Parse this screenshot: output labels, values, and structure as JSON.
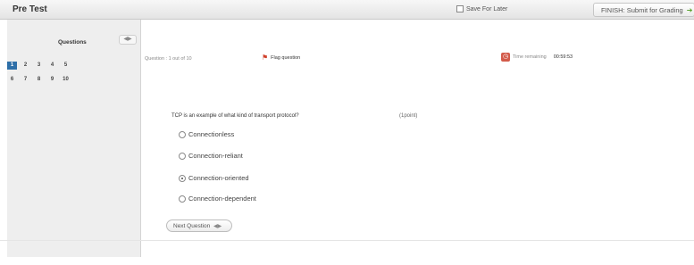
{
  "header": {
    "title": "Pre Test",
    "save_label": "Save For Later",
    "finish_label": "FINISH: Submit for Grading",
    "finish_arrow": "➔"
  },
  "sidebar": {
    "heading": "Questions",
    "collapse_icon": "◀▶",
    "row1": [
      "1",
      "2",
      "3",
      "4",
      "5"
    ],
    "row2": [
      "6",
      "7",
      "8",
      "9",
      "10"
    ],
    "current": "1"
  },
  "question": {
    "counter": "Question : 1 out of 10",
    "flag_label": "Flag question",
    "time_label": "Time remaining",
    "time_value": "00:59:53",
    "text": "TCP is an example of what kind of transport protocol?",
    "points": "(1point)",
    "options": [
      "Connectionless",
      "Connection-reliant",
      "Connection-oriented",
      "Connection-dependent"
    ],
    "selected_index": 2
  },
  "nav": {
    "next_label": "Next Question",
    "next_arrow": "◀▶"
  },
  "colors": {
    "current_question": "#2e6fa8",
    "flag": "#d0402b",
    "timer_icon": "#d35b4a",
    "finish_arrow": "#5aa32f"
  }
}
